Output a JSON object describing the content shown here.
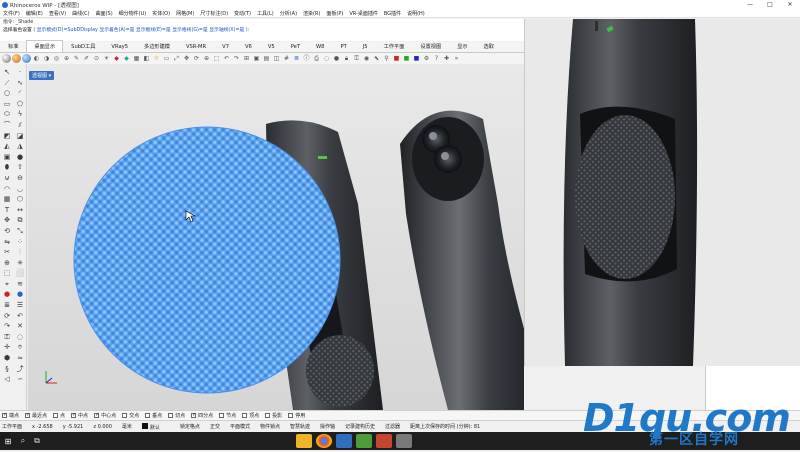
{
  "window": {
    "title": "Rhinoceros WIP - [透视图]",
    "controls": [
      "—",
      "□",
      "✕"
    ]
  },
  "menu": [
    "文件(F)",
    "编辑(E)",
    "查看(V)",
    "曲线(C)",
    "曲面(S)",
    "细分物件(U)",
    "实体(O)",
    "网格(M)",
    "尺寸标注(D)",
    "变动(T)",
    "工具(L)",
    "分析(A)",
    "渲染(R)",
    "面板(P)",
    "VR-桌面插件",
    "BG插件",
    "说明(H)"
  ],
  "command": {
    "history": "指令: _Shade",
    "prompt_label": "选择着色设置",
    "prompt_rest": "( 显示模式(D)=SubDDisplay 显示着色(A)=是 显示框线(E)=是 显示格线(G)=是 显示轴线(X)=是 ):"
  },
  "tabs": {
    "items": [
      "标准",
      "桌面显示",
      "SubD工具",
      "VRay5",
      "多边形建模",
      "VSR-MR",
      "V7",
      "V6",
      "V5",
      "PeT",
      "W8",
      "PT",
      "J5",
      "工作平面",
      "设置视图",
      "显示",
      "选取"
    ],
    "active_index": 1
  },
  "viewport": {
    "label": "透视图 ▾"
  },
  "snaps": {
    "items": [
      {
        "label": "端点",
        "checked": true
      },
      {
        "label": "最近点",
        "checked": true
      },
      {
        "label": "点",
        "checked": false
      },
      {
        "label": "中点",
        "checked": true
      },
      {
        "label": "中心点",
        "checked": true
      },
      {
        "label": "交点",
        "checked": false
      },
      {
        "label": "垂点",
        "checked": false
      },
      {
        "label": "切点",
        "checked": false
      },
      {
        "label": "四分点",
        "checked": true
      },
      {
        "label": "节点",
        "checked": false
      },
      {
        "label": "顶点",
        "checked": false
      },
      {
        "label": "投影",
        "checked": false
      },
      {
        "label": "停用",
        "checked": false
      }
    ]
  },
  "status": {
    "cplane": "工作平面",
    "x": "x -2.658",
    "y": "y -5.921",
    "z": "z 0.000",
    "unit": "毫米",
    "layer": "默认",
    "toggles": [
      "锁定格点",
      "正交",
      "平面模式",
      "物件锁点",
      "智慧轨迹",
      "操作轴",
      "记录建构历史",
      "过滤器"
    ],
    "save_info": "距离上次保存的时间 (分钟): 81"
  },
  "watermark": {
    "brand": "D1qu.com",
    "subtitle": "第一区自学网"
  },
  "colors": {
    "accent": "#3b70c4",
    "disc": "#5aa2f0",
    "logo": "#1f78c8"
  },
  "icons": [
    "start-icon",
    "search-icon",
    "taskview-icon",
    "explorer-icon",
    "chrome-icon",
    "rhino-icon",
    "app-icon"
  ]
}
